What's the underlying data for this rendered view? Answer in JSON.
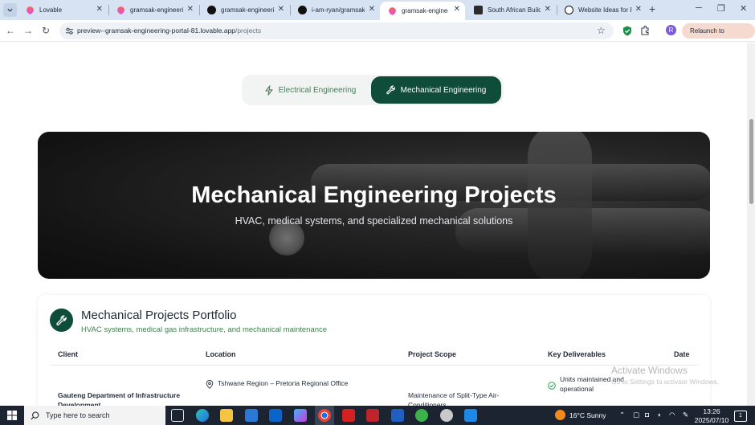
{
  "browser": {
    "tabs": [
      {
        "title": "Lovable",
        "icon": "lovable-heart-icon",
        "active": false
      },
      {
        "title": "gramsak-engineerin",
        "icon": "lovable-heart-icon",
        "active": false
      },
      {
        "title": "gramsak-engineerin",
        "icon": "github-icon",
        "active": false
      },
      {
        "title": "i-am-ryan/gramsak-",
        "icon": "github-icon",
        "active": false
      },
      {
        "title": "gramsak-engineerin",
        "icon": "lovable-heart-icon",
        "active": true
      },
      {
        "title": "South African Buildi",
        "icon": "site-icon",
        "active": false
      },
      {
        "title": "Website Ideas for Bu",
        "icon": "chatgpt-icon",
        "active": false
      }
    ],
    "new_tab_symbol": "+",
    "url_host": "preview--gramsak-engineering-portal-81.lovable.app",
    "url_path": "/projects",
    "relaunch_label": "Relaunch to update",
    "profile_initial": "R"
  },
  "page": {
    "toggle": {
      "electrical_label": "Electrical Engineering",
      "mechanical_label": "Mechanical Engineering",
      "selected": "Mechanical Engineering"
    },
    "hero": {
      "title": "Mechanical Engineering Projects",
      "subtitle": "HVAC, medical systems, and specialized mechanical solutions"
    },
    "portfolio": {
      "title": "Mechanical Projects Portfolio",
      "subtitle": "HVAC systems, medical gas infrastructure, and mechanical maintenance",
      "columns": [
        "Client",
        "Location",
        "Project Scope",
        "Key Deliverables",
        "Date"
      ],
      "rows": [
        {
          "client": "Gauteng Department of Infrastructure Development",
          "location": "Tshwane Region – Pretoria Regional Office",
          "scope": "Maintenance of Split-Type Air-Conditioners",
          "deliverable": "Units maintained and operational"
        }
      ]
    },
    "watermark": {
      "line1": "Activate Windows",
      "line2": "Go to Settings to activate Windows."
    }
  },
  "taskbar": {
    "search_placeholder": "Type here to search",
    "weather": "16°C  Sunny",
    "time": "13:26",
    "date": "2025/07/10",
    "notification_count": "1"
  }
}
